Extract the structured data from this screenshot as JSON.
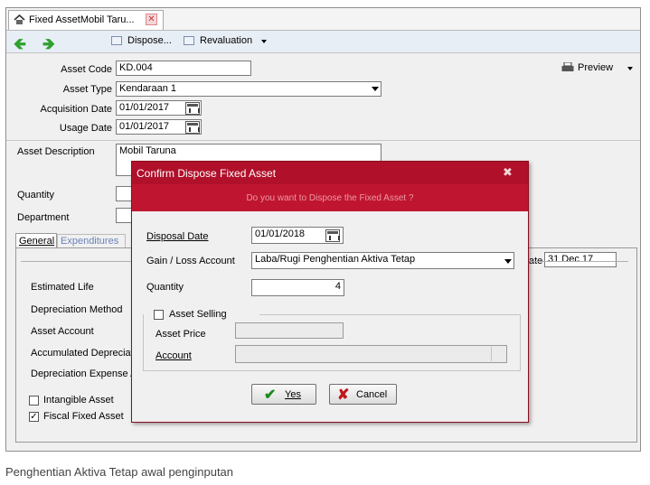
{
  "tab": {
    "title": "Fixed AssetMobil Taru..."
  },
  "toolbar": {
    "dispose_label": "Dispose...",
    "revaluation_label": "Revaluation",
    "preview_label": "Preview"
  },
  "form": {
    "asset_code_label": "Asset Code",
    "asset_code": "KD.004",
    "asset_type_label": "Asset Type",
    "asset_type": "Kendaraan 1",
    "acquisition_date_label": "Acquisition Date",
    "acquisition_date": "01/01/2017",
    "usage_date_label": "Usage Date",
    "usage_date": "01/01/2017",
    "asset_description_label": "Asset Description",
    "asset_description": "Mobil Taruna",
    "quantity_label": "Quantity",
    "department_label": "Department"
  },
  "tabs": {
    "general": "General",
    "expenditures": "Expenditures"
  },
  "general": {
    "date_label_tail": "ate",
    "date_value": "31 Dec 17",
    "estimated_life": "Estimated Life",
    "depreciation_method": "Depreciation Method",
    "asset_account": "Asset Account",
    "accumulated_depreciation": "Accumulated Depreciat",
    "depreciation_expense": "Depreciation Expense A",
    "intangible_asset": "Intangible Asset",
    "fiscal_fixed_asset": "Fiscal Fixed Asset"
  },
  "dialog": {
    "title": "Confirm Dispose Fixed Asset",
    "question": "Do you want to Dispose the Fixed Asset ?",
    "disposal_date_label": "Disposal Date",
    "disposal_date": "01/01/2018",
    "gain_loss_label": "Gain / Loss Account",
    "gain_loss_value": "Laba/Rugi Penghentian Aktiva Tetap",
    "quantity_label": "Quantity",
    "quantity_value": "4",
    "asset_selling_label": "Asset Selling",
    "asset_price_label": "Asset Price",
    "account_label": "Account",
    "yes_label": "Yes",
    "cancel_label": "Cancel"
  },
  "caption": "Penghentian Aktiva Tetap awal penginputan",
  "colors": {
    "dialog_title_bg": "#b0102a",
    "dialog_banner_bg": "#c01530",
    "yes_icon": "#1f8a1f",
    "cancel_icon": "#c0171c"
  }
}
